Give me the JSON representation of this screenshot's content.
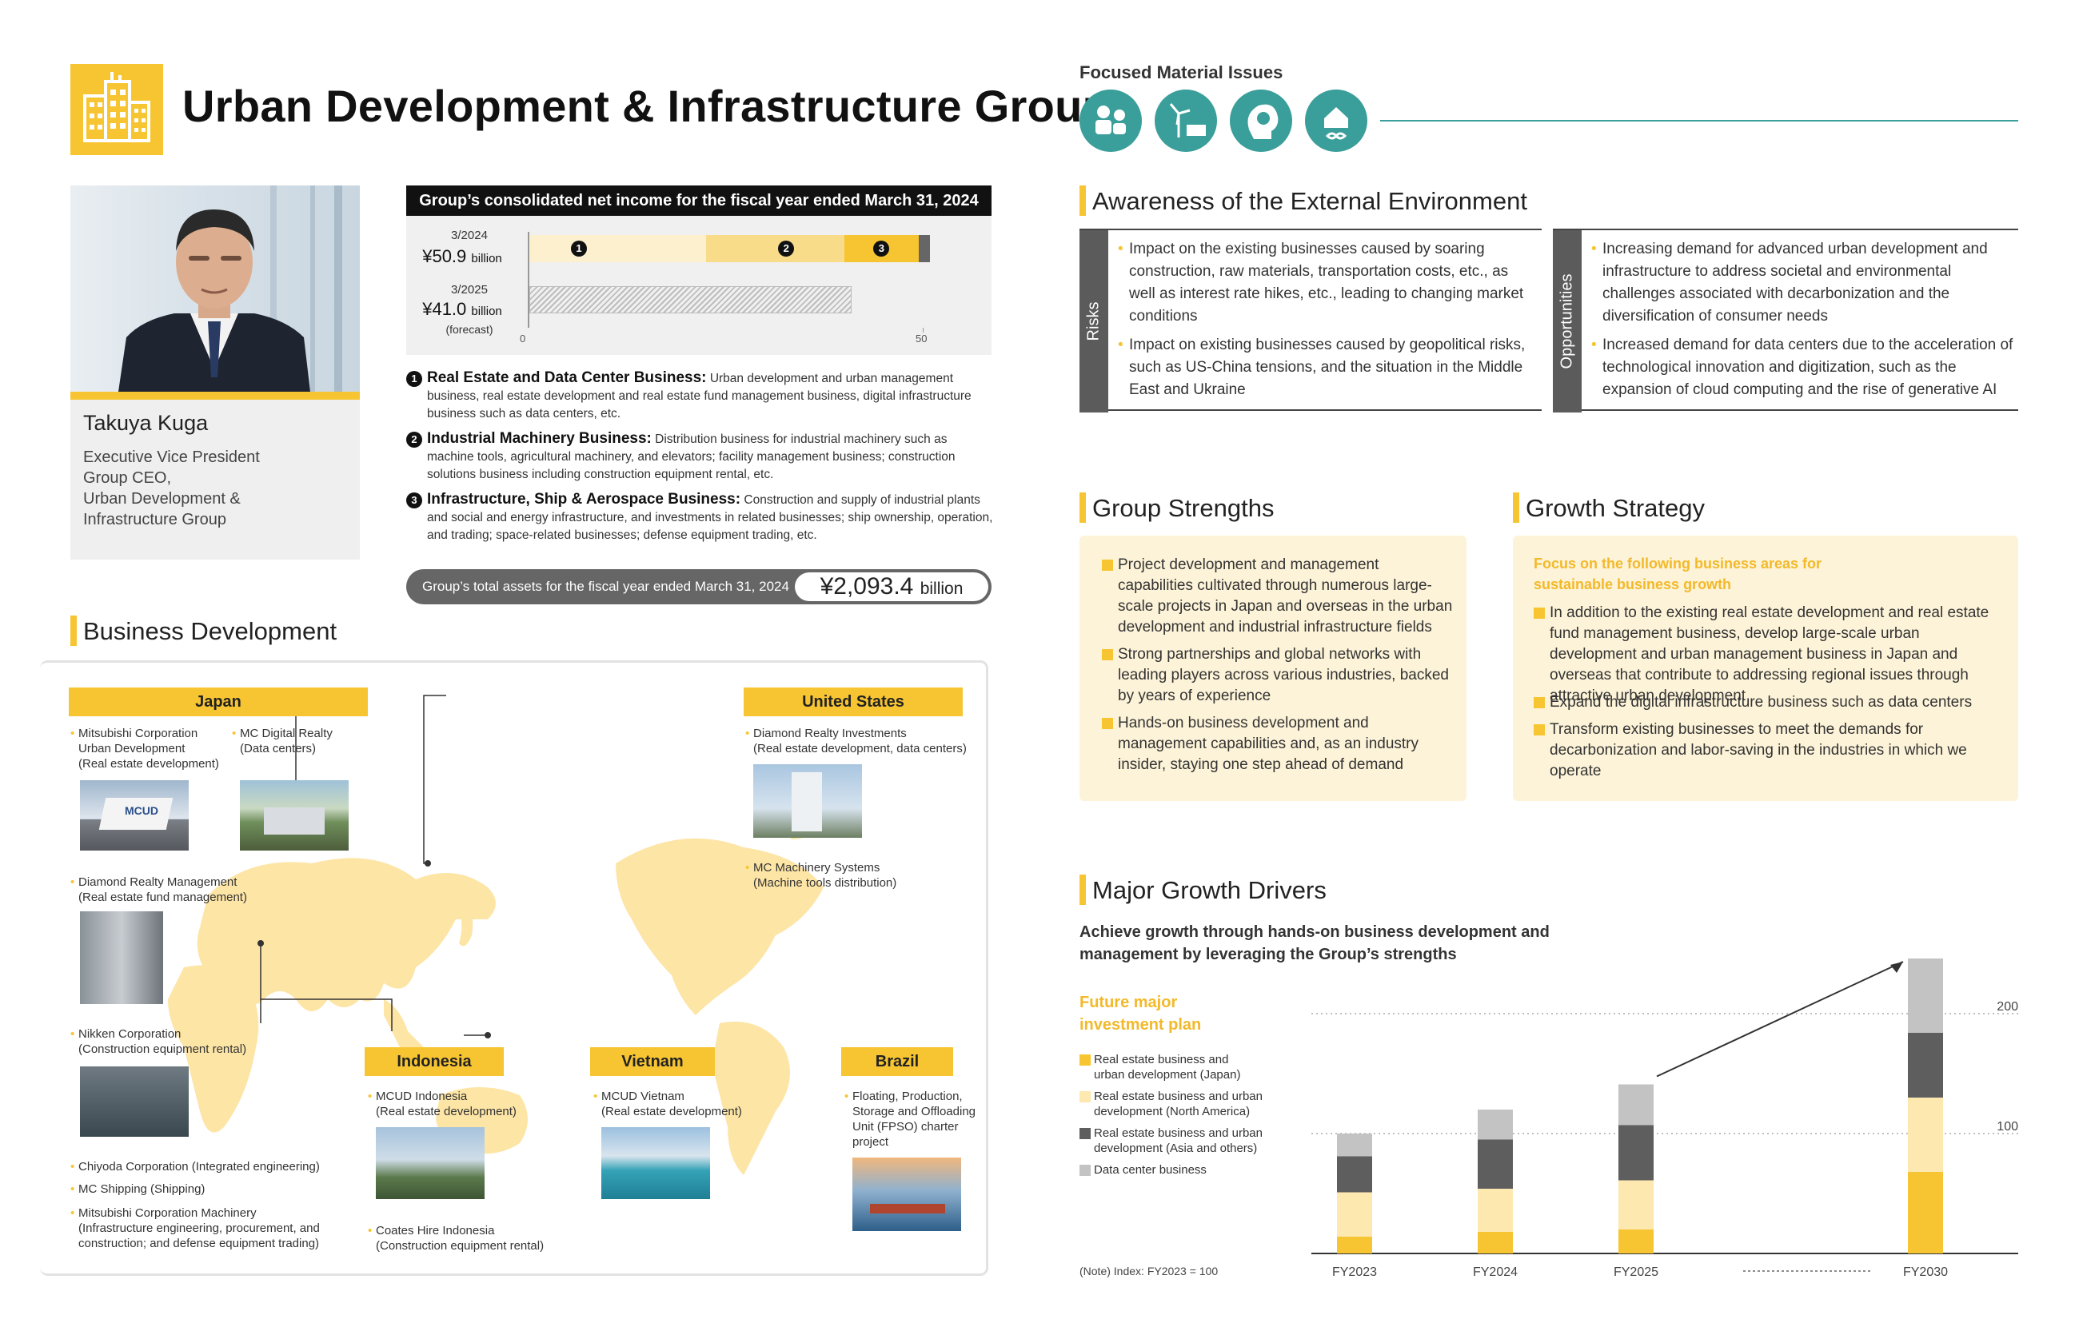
{
  "header": {
    "title": "Urban Development & Infrastructure Group"
  },
  "executive": {
    "name": "Takuya Kuga",
    "title": "Executive Vice President\nGroup CEO,\nUrban Development &\nInfrastructure Group"
  },
  "net_income": {
    "heading": "Group’s consolidated net income for the fiscal year ended March 31, 2024",
    "rows": [
      {
        "period": "3/2024",
        "value": "¥50.9",
        "unit": "billion",
        "note": ""
      },
      {
        "period": "3/2025",
        "value": "¥41.0",
        "unit": "billion",
        "note": "(forecast)"
      }
    ],
    "axis_ticks": [
      "0",
      "50"
    ],
    "segment_markers": [
      "1",
      "2",
      "3"
    ]
  },
  "segments": [
    {
      "num": "1",
      "name": "Real Estate and Data Center Business:",
      "desc": "Urban development and urban management business, real estate development and real estate fund management business, digital infrastructure business such as data centers, etc."
    },
    {
      "num": "2",
      "name": "Industrial Machinery Business:",
      "desc": "Distribution business for industrial machinery such as machine tools, agricultural machinery, and elevators; facility management business; construction solutions business including construction equipment rental, etc."
    },
    {
      "num": "3",
      "name": "Infrastructure, Ship & Aerospace Business:",
      "desc": "Construction and supply of industrial plants and social and energy infrastructure, and investments in related businesses; ship ownership, operation, and trading; space-related businesses; defense equipment trading, etc."
    }
  ],
  "total_assets": {
    "label": "Group’s total assets for the fiscal year ended March 31, 2024",
    "value": "¥2,093.4",
    "unit": "billion"
  },
  "business_development": {
    "title": "Business Development",
    "regions": {
      "japan": "Japan",
      "us": "United States",
      "indonesia": "Indonesia",
      "vietnam": "Vietnam",
      "brazil": "Brazil"
    },
    "entries": {
      "mcud": "Mitsubishi Corporation\nUrban Development\n(Real estate development)",
      "mcdr": "MC Digital Realty\n(Data centers)",
      "drm": "Diamond Realty Management\n(Real estate fund management)",
      "nikken": "Nikken Corporation\n(Construction equipment rental)",
      "chiyoda": "Chiyoda Corporation (Integrated engineering)",
      "mcship": "MC Shipping (Shipping)",
      "mcm": "Mitsubishi Corporation Machinery\n(Infrastructure engineering, procurement, and\nconstruction; and defense equipment trading)",
      "dri": "Diamond Realty Investments\n(Real estate development, data centers)",
      "mcms": "MC Machinery Systems\n(Machine tools distribution)",
      "mcud_id": "MCUD Indonesia\n(Real estate development)",
      "coates": "Coates Hire Indonesia\n(Construction equipment rental)",
      "mcud_vn": "MCUD Vietnam\n(Real estate development)",
      "fpso": "Floating, Production,\nStorage and Offloading\nUnit (FPSO) charter\nproject"
    },
    "photo_sign": "MCUD"
  },
  "focused_issues": {
    "label": "Focused Material Issues",
    "icons": [
      "society-people-icon",
      "renewable-energy-icon",
      "innovation-lightbulb-icon",
      "circular-infrastructure-icon"
    ]
  },
  "external_env": {
    "title": "Awareness of the External Environment",
    "risks_label": "Risks",
    "risks": [
      "Impact on the existing businesses caused by soaring construction, raw materials, transportation costs, etc., as well as interest rate hikes, etc., leading to changing market conditions",
      "Impact on existing businesses caused by geopolitical risks, such as US-China tensions, and the situation in the Middle East and Ukraine"
    ],
    "opportunities_label": "Opportunities",
    "opportunities": [
      "Increasing demand for advanced urban development and infrastructure to address societal and environmental challenges associated with decarbonization and the diversification of consumer needs",
      "Increased demand for data centers due to the acceleration of technological innovation and digitization, such as the expansion of cloud computing and the rise of generative AI"
    ]
  },
  "strengths": {
    "title": "Group Strengths",
    "items": [
      "Project development and management capabilities cultivated through numerous large-scale projects in Japan and overseas in the urban development and industrial infrastructure fields",
      "Strong partnerships and global networks with leading players across various industries, backed by years of experience",
      "Hands-on business development and management capabilities and, as an industry insider, staying one step ahead of demand"
    ]
  },
  "growth_strategy": {
    "title": "Growth Strategy",
    "focus": "Focus on the following business areas for sustainable business growth",
    "items": [
      "In addition to the existing real estate development and real estate fund management business, develop large-scale urban development and urban management business in Japan and overseas that contribute to addressing regional issues through attractive urban development",
      "Expand the digital infrastructure business such as data centers",
      "Transform existing businesses to meet the demands for decarbonization and labor-saving in the industries in which we operate"
    ]
  },
  "growth_drivers": {
    "title": "Major Growth Drivers",
    "subtitle": "Achieve growth through hands-on business development and management by leveraging the Group’s strengths",
    "plan_title": "Future major investment plan",
    "note": "(Note) Index: FY2023 = 100"
  },
  "chart_data": [
    {
      "type": "bar",
      "orientation": "horizontal",
      "stacked": true,
      "title": "Group’s consolidated net income for the fiscal year ended March 31, 2024",
      "categories": [
        "3/2024",
        "3/2025"
      ],
      "series": [
        {
          "name": "1",
          "values": [
            22.5,
            null
          ]
        },
        {
          "name": "2",
          "values": [
            17.5,
            null
          ]
        },
        {
          "name": "3",
          "values": [
            9.5,
            null
          ]
        },
        {
          "name": "",
          "values": [
            1.4,
            null
          ]
        },
        {
          "name": "(forecast)",
          "values": [
            null,
            41.0
          ]
        }
      ],
      "totals": [
        50.9,
        41.0
      ],
      "xlim": [
        0,
        55
      ],
      "ticks": [
        0,
        50
      ],
      "colors": [
        "#fdf0cf",
        "#f9dc8a",
        "#f7c532",
        "#666666",
        "#bbbbbb"
      ]
    },
    {
      "type": "bar",
      "stacked": true,
      "categories": [
        "FY2023",
        "FY2024",
        "FY2025",
        "FY2030"
      ],
      "series": [
        {
          "name": "Real estate business and urban development (Japan)",
          "values": [
            14,
            18,
            20,
            68
          ],
          "color": "#f7c532"
        },
        {
          "name": "Real estate business and urban development (North America)",
          "values": [
            37,
            36,
            41,
            62
          ],
          "color": "#fde8b0"
        },
        {
          "name": "Real estate business and urban development (Asia and others)",
          "values": [
            30,
            41,
            46,
            54
          ],
          "color": "#5e5e5e"
        },
        {
          "name": "Data center business",
          "values": [
            19,
            25,
            34,
            62
          ],
          "color": "#c3c3c3"
        }
      ],
      "ylim": [
        0,
        250
      ],
      "yticks": [
        100,
        200
      ],
      "gridlines": "dotted at 100 and 200",
      "annotation": "arrow from FY2025 to FY2030"
    }
  ]
}
